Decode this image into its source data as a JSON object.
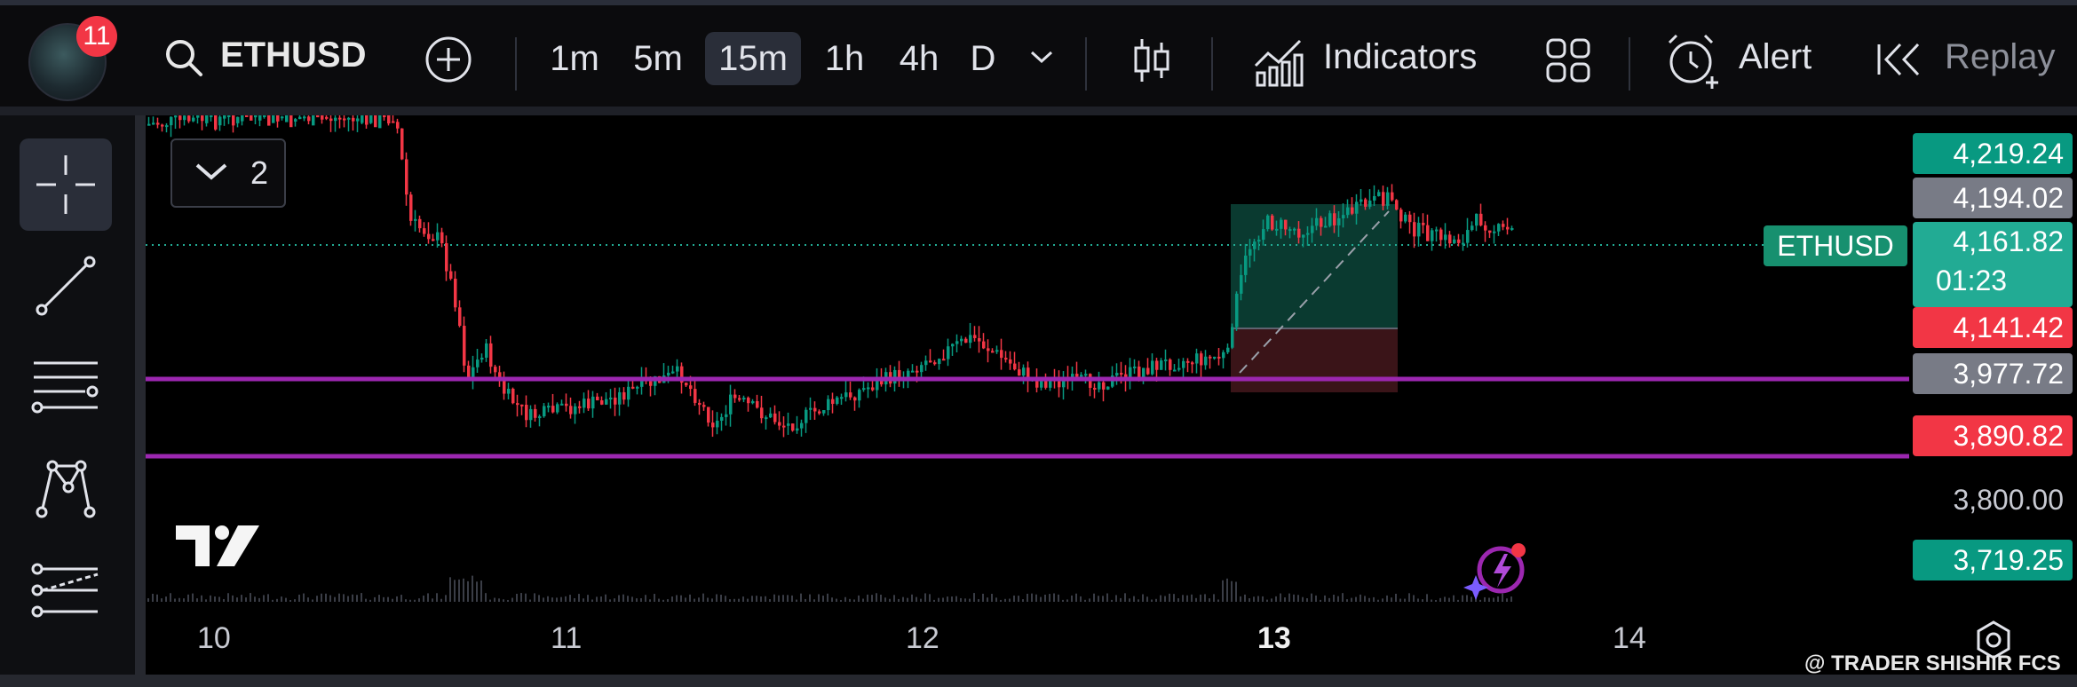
{
  "toolbar": {
    "notification_count": "11",
    "symbol": "ETHUSD",
    "timeframes": [
      "1m",
      "5m",
      "15m",
      "1h",
      "4h",
      "D"
    ],
    "active_timeframe": "15m",
    "indicators_label": "Indicators",
    "alert_label": "Alert",
    "replay_label": "Replay"
  },
  "legend": {
    "count": "2"
  },
  "price_scale": {
    "labels": [
      {
        "value": "4,219.24",
        "color": "#089981"
      },
      {
        "value": "4,194.02",
        "color": "#787b86"
      },
      {
        "value": "4,141.42",
        "color": "#f23645"
      },
      {
        "value": "3,977.72",
        "color": "#787b86"
      },
      {
        "value": "3,890.82",
        "color": "#f23645"
      },
      {
        "value": "3,800.00",
        "color": ""
      },
      {
        "value": "3,719.25",
        "color": "#089981"
      }
    ],
    "current_price": "4,161.82",
    "countdown": "01:23",
    "symbol_tag": "ETHUSD"
  },
  "time_axis": {
    "ticks": [
      "10",
      "11",
      "12",
      "13",
      "14"
    ],
    "bold_tick": "13"
  },
  "watermark": "@ TRADER SHISHIR FCS",
  "colors": {
    "up": "#089981",
    "down": "#f23645",
    "level_line": "#9c27b0",
    "accent": "#22ab94"
  }
}
